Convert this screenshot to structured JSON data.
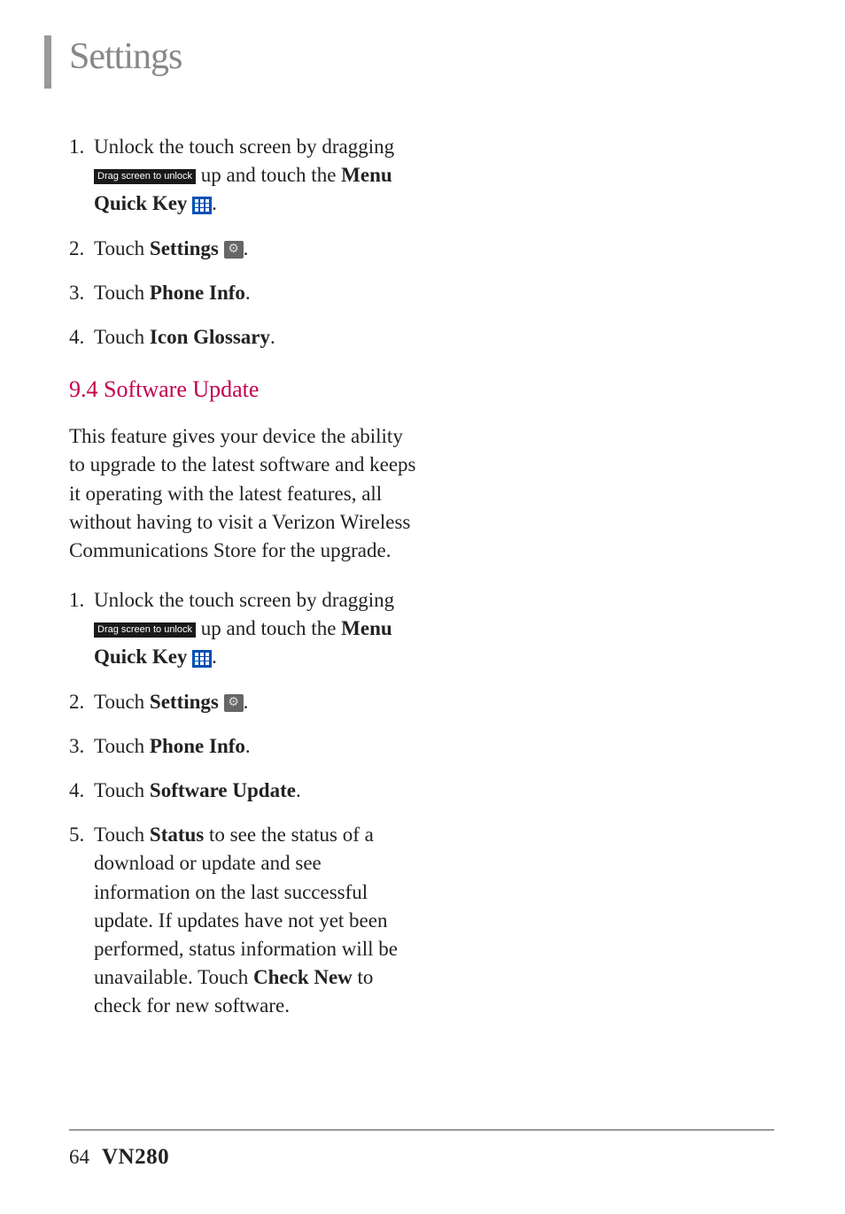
{
  "heading": "Settings",
  "section1": {
    "steps": [
      {
        "num": "1.",
        "parts": [
          {
            "t": "Unlock the touch screen by dragging "
          },
          {
            "icon": "drag",
            "label": "Drag screen to unlock"
          },
          {
            "t": " up and touch the "
          },
          {
            "t": "Menu Quick Key ",
            "bold": true
          },
          {
            "icon": "menu"
          },
          {
            "t": "."
          }
        ]
      },
      {
        "num": "2.",
        "parts": [
          {
            "t": "Touch "
          },
          {
            "t": "Settings ",
            "bold": true
          },
          {
            "icon": "gear"
          },
          {
            "t": "."
          }
        ]
      },
      {
        "num": "3.",
        "parts": [
          {
            "t": " Touch "
          },
          {
            "t": "Phone Info",
            "bold": true
          },
          {
            "t": "."
          }
        ]
      },
      {
        "num": "4.",
        "parts": [
          {
            "t": " Touch "
          },
          {
            "t": "Icon Glossary",
            "bold": true
          },
          {
            "t": "."
          }
        ]
      }
    ]
  },
  "section2": {
    "heading": "9.4 Software Update",
    "intro": "This feature gives your device the ability to upgrade to the latest software and keeps it operating with the latest features, all without having to visit a Verizon Wireless Communications Store for the upgrade.",
    "steps": [
      {
        "num": "1.",
        "parts": [
          {
            "t": "Unlock the touch screen by dragging "
          },
          {
            "icon": "drag",
            "label": "Drag screen to unlock"
          },
          {
            "t": " up and touch the "
          },
          {
            "t": "Menu Quick Key ",
            "bold": true
          },
          {
            "icon": "menu"
          },
          {
            "t": "."
          }
        ]
      },
      {
        "num": "2.",
        "parts": [
          {
            "t": "Touch "
          },
          {
            "t": "Settings ",
            "bold": true
          },
          {
            "icon": "gear"
          },
          {
            "t": "."
          }
        ]
      },
      {
        "num": "3.",
        "parts": [
          {
            "t": " Touch "
          },
          {
            "t": "Phone Info",
            "bold": true
          },
          {
            "t": "."
          }
        ]
      },
      {
        "num": "4.",
        "parts": [
          {
            "t": " Touch "
          },
          {
            "t": "Software Update",
            "bold": true
          },
          {
            "t": "."
          }
        ]
      },
      {
        "num": "5.",
        "parts": [
          {
            "t": " Touch "
          },
          {
            "t": "Status",
            "bold": true
          },
          {
            "t": " to see the status of a download or update and see information on the last successful update. If updates have not yet been performed, status information will be unavailable. Touch "
          },
          {
            "t": "Check New",
            "bold": true
          },
          {
            "t": " to check for new software."
          }
        ]
      }
    ]
  },
  "footer": {
    "page": "64",
    "model": "VN280"
  }
}
